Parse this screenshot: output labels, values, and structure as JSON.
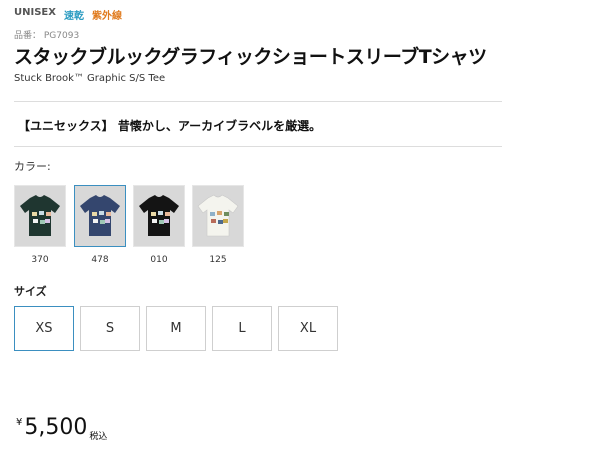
{
  "tags": {
    "unisex": "UNISEX",
    "quick_dry": "速乾",
    "uv": "紫外線"
  },
  "product_number": "品番： PG7093",
  "title": "スタックブルックグラフィックショートスリーブTシャツ",
  "subtitle": "Stuck Brook™ Graphic S/S Tee",
  "catch_copy": "【ユニセックス】 昔懐かし、アーカイブラベルを厳選。",
  "color_label": "カラー:",
  "colors": [
    {
      "code": "370",
      "shirt": "#1f3630",
      "bg": "#d8d8d8",
      "selected": false
    },
    {
      "code": "478",
      "shirt": "#34466e",
      "bg": "#d8d8d8",
      "selected": true
    },
    {
      "code": "010",
      "shirt": "#141414",
      "bg": "#d8d8d8",
      "selected": false
    },
    {
      "code": "125",
      "shirt": "#f4f4ee",
      "bg": "#d8d8d8",
      "selected": false
    }
  ],
  "size_label": "サイズ",
  "sizes": [
    {
      "label": "XS",
      "selected": true
    },
    {
      "label": "S",
      "selected": false
    },
    {
      "label": "M",
      "selected": false
    },
    {
      "label": "L",
      "selected": false
    },
    {
      "label": "XL",
      "selected": false
    }
  ],
  "price": {
    "currency": "¥",
    "amount": "5,500",
    "tax_note": "税込"
  },
  "colors_theme": {
    "accent": "#3b8fc0",
    "quick_dry": "#2a9bc1",
    "uv": "#e07b1e"
  }
}
